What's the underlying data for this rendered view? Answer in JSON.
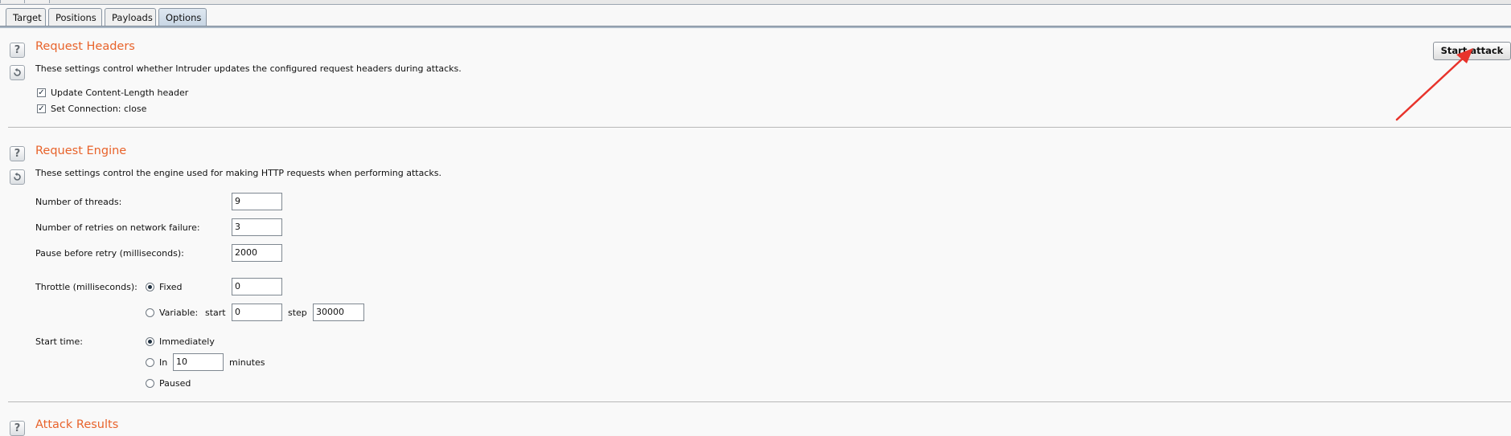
{
  "tabs": [
    {
      "label": "Target",
      "active": false
    },
    {
      "label": "Positions",
      "active": false
    },
    {
      "label": "Payloads",
      "active": false
    },
    {
      "label": "Options",
      "active": true
    }
  ],
  "colors": {
    "section_title": "#e8632b",
    "annotation_arrow": "#e8332b"
  },
  "start_attack": {
    "label": "Start attack"
  },
  "request_headers": {
    "title": "Request Headers",
    "description": "These settings control whether Intruder updates the configured request headers during attacks.",
    "options": [
      {
        "label": "Update Content-Length header",
        "checked": true
      },
      {
        "label": "Set Connection: close",
        "checked": true
      }
    ]
  },
  "request_engine": {
    "title": "Request Engine",
    "description": "These settings control the engine used for making HTTP requests when performing attacks.",
    "threads": {
      "label": "Number of threads:",
      "value": "9"
    },
    "retries": {
      "label": "Number of retries on network failure:",
      "value": "3"
    },
    "pause": {
      "label": "Pause before retry (milliseconds):",
      "value": "2000"
    },
    "throttle": {
      "label": "Throttle (milliseconds):",
      "fixed_label": "Fixed",
      "fixed_value": "0",
      "fixed_selected": true,
      "variable_label": "Variable:",
      "start_label": "start",
      "start_value": "0",
      "step_label": "step",
      "step_value": "30000"
    },
    "start_time": {
      "label": "Start time:",
      "immediately_label": "Immediately",
      "immediately_selected": true,
      "in_label": "In",
      "in_value": "10",
      "minutes_label": "minutes",
      "paused_label": "Paused"
    }
  },
  "attack_results": {
    "title": "Attack Results"
  },
  "icons": {
    "help": "help-icon",
    "reset": "reset-icon",
    "check": "check-mark"
  }
}
